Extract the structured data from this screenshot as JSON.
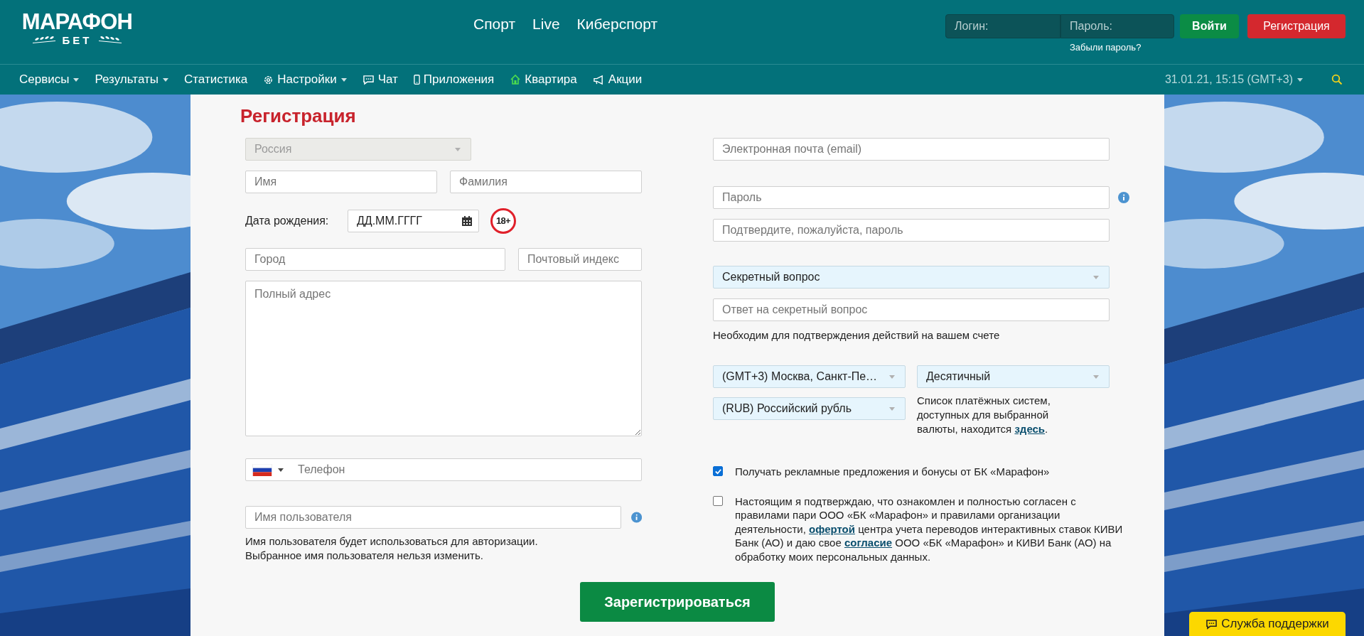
{
  "header": {
    "logo": {
      "title": "МАРАФОН",
      "subtitle": "БЕТ"
    },
    "top_nav": [
      {
        "label": "Спорт"
      },
      {
        "label": "Live"
      },
      {
        "label": "Киберспорт"
      }
    ],
    "login": {
      "login_placeholder": "Логин:",
      "password_placeholder": "Пароль:",
      "forgot_link": "Забыли пароль?",
      "login_button": "Войти",
      "register_button": "Регистрация"
    }
  },
  "nav": {
    "items": [
      {
        "label": "Сервисы",
        "dropdown": true
      },
      {
        "label": "Результаты",
        "dropdown": true
      },
      {
        "label": "Статистика",
        "dropdown": false
      },
      {
        "label": "Настройки",
        "dropdown": true
      },
      {
        "label": "Чат",
        "dropdown": false
      },
      {
        "label": "Приложения",
        "dropdown": false
      },
      {
        "label": "Квартира",
        "dropdown": false
      },
      {
        "label": "Акции",
        "dropdown": false
      }
    ],
    "datetime": "31.01.21, 15:15 (GMT+3)"
  },
  "form": {
    "title": "Регистрация",
    "country": {
      "value": "Россия",
      "disabled": true
    },
    "first_name": {
      "placeholder": "Имя"
    },
    "last_name": {
      "placeholder": "Фамилия"
    },
    "birth_date": {
      "label": "Дата рождения:",
      "placeholder": "ДД.ММ.ГГГГ"
    },
    "age_badge": "18+",
    "city": {
      "placeholder": "Город"
    },
    "postcode": {
      "placeholder": "Почтовый индекс"
    },
    "address": {
      "placeholder": "Полный адрес"
    },
    "phone": {
      "placeholder": "Телефон"
    },
    "username": {
      "placeholder": "Имя пользователя"
    },
    "username_hint": [
      "Имя пользователя будет использоваться для авторизации.",
      "Выбранное имя пользователя нельзя изменить."
    ],
    "email": {
      "placeholder": "Электронная почта (email)"
    },
    "password": {
      "placeholder": "Пароль"
    },
    "password_confirm": {
      "placeholder": "Подтвердите, пожалуйста, пароль"
    },
    "secret_question": {
      "value": "Секретный вопрос"
    },
    "secret_answer": {
      "placeholder": "Ответ на секретный вопрос"
    },
    "secret_note": "Необходим для подтверждения действий на вашем счете",
    "timezone": {
      "value": "(GMT+3) Москва, Санкт-Пе…"
    },
    "odds_format": {
      "value": "Десятичный"
    },
    "currency": {
      "value": "(RUB) Российский рубль"
    },
    "payment_note": [
      {
        "kind": "text",
        "text": "Список платёжных систем, доступных для выбранной валюты, находится "
      },
      {
        "kind": "link",
        "text": "здесь"
      },
      {
        "kind": "text",
        "text": "."
      }
    ],
    "checkboxes": [
      {
        "checked": true,
        "parts": [
          {
            "kind": "text",
            "text": "Получать рекламные предложения и бонусы от БК «Марафон»"
          }
        ]
      },
      {
        "checked": false,
        "parts": [
          {
            "kind": "text",
            "text": "Настоящим я подтверждаю, что ознакомлен и полностью согласен с правилами пари ООО «БК «Марафон» и правилами организации деятельности, "
          },
          {
            "kind": "link",
            "text": "офертой"
          },
          {
            "kind": "text",
            "text": " центра учета переводов интерактивных ставок КИВИ Банк (АО) и даю свое "
          },
          {
            "kind": "link",
            "text": "согласие"
          },
          {
            "kind": "text",
            "text": " ООО «БК «Марафон» и КИВИ Банк (АО) на обработку моих персональных данных."
          }
        ]
      }
    ],
    "submit": "Зарегистрироваться"
  },
  "support_button": "Служба поддержки"
}
